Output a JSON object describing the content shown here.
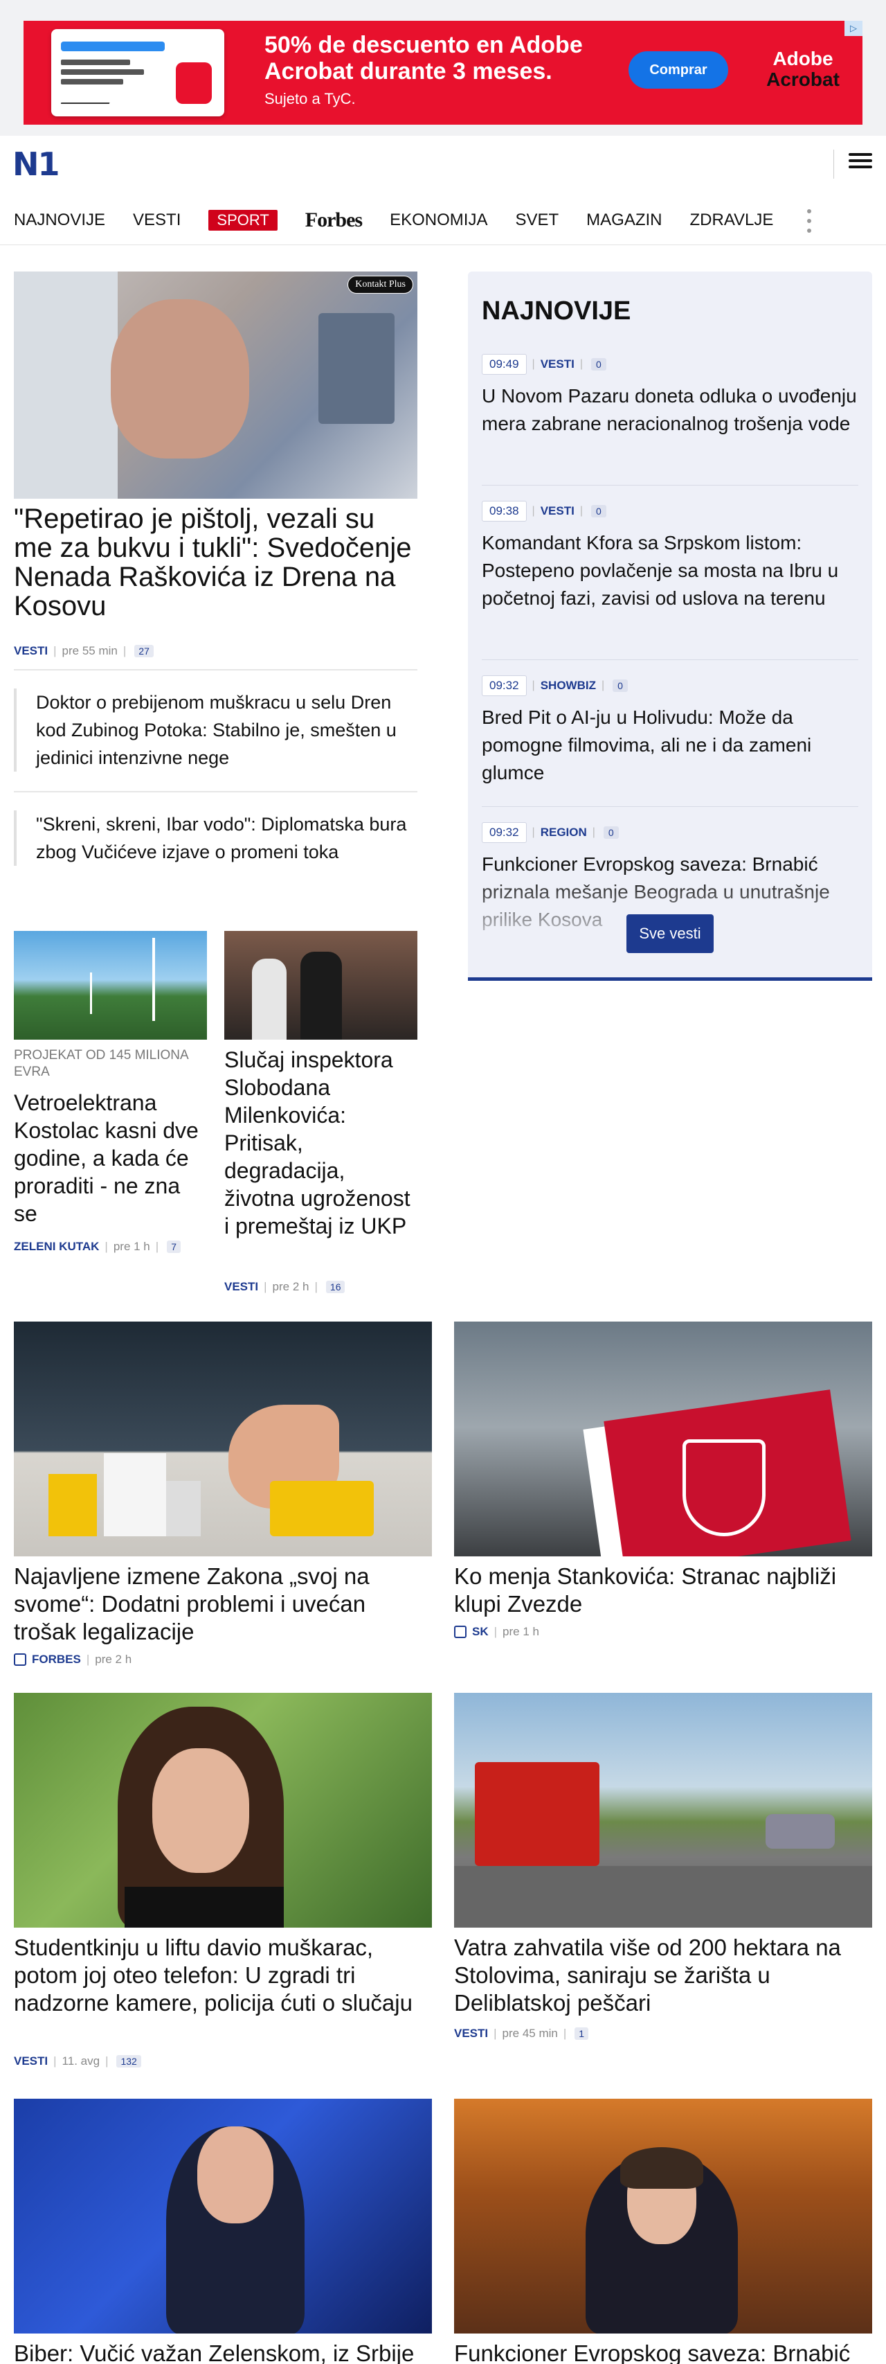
{
  "ad": {
    "headline": "50% de descuento en Adobe Acrobat durante 3 meses.",
    "subline": "Sujeto a TyC.",
    "cta": "Comprar",
    "brand_line1": "Adobe",
    "brand_line2": "Acrobat",
    "corner": "▷",
    "brand_color": "#e8112d"
  },
  "header": {
    "logo": "N1",
    "menu_icon": "hamburger-icon",
    "brand_color": "#1d3a8f"
  },
  "nav": {
    "items": [
      "NAJNOVIJE",
      "VESTI",
      "SPORT",
      "Forbes",
      "EKONOMIJA",
      "SVET",
      "MAGAZIN",
      "ZDRAVLJE"
    ],
    "more_icon": "vertical-dots-icon"
  },
  "lead": {
    "image_badge": "Kontakt Plus",
    "title": "\"Repetirao je pištolj, vezali su me za bukvu i tukli\": Svedočenje Nenada Raškovića iz Drena na Kosovu",
    "category": "VESTI",
    "time": "pre 55 min",
    "comments": "27"
  },
  "related": [
    {
      "title": "Doktor o prebijenom muškracu u selu Dren kod Zubinog Potoka: Stabilno je, smešten u jedinici intenzivne nege"
    },
    {
      "title": "\"Skreni, skreni, Ibar vodo\": Diplomatska bura zbog Vučićeve izjave o promeni toka"
    }
  ],
  "small_cards": [
    {
      "kicker": "PROJEKAT OD 145 MILIONA EVRA",
      "title": "Vetroelektrana Kostolac kasni dve godine, a kada će proraditi - ne zna se",
      "category": "ZELENI KUTAK",
      "time": "pre 1 h",
      "comments": "7"
    },
    {
      "title": "Slučaj inspektora Slobodana Milenkovića: Pritisak, degradacija, životna ugroženost i premeštaj iz UKP",
      "category": "VESTI",
      "time": "pre 2 h",
      "comments": "16"
    }
  ],
  "latest": {
    "heading": "NAJNOVIJE",
    "items": [
      {
        "time": "09:49",
        "category": "VESTI",
        "comments": "0",
        "title": "U Novom Pazaru doneta odluka o uvođenju mera zabrane neracionalnog trošenja vode"
      },
      {
        "time": "09:38",
        "category": "VESTI",
        "comments": "0",
        "title": "Komandant Kfora sa Srpskom listom: Postepeno povlačenje sa mosta na Ibru u početnoj fazi, zavisi od uslova na terenu"
      },
      {
        "time": "09:32",
        "category": "SHOWBIZ",
        "comments": "0",
        "title": "Bred Pit o AI-ju u Holivudu: Može da pomogne filmovima, ali ne i da zameni glumce"
      },
      {
        "time": "09:32",
        "category": "REGION",
        "comments": "0",
        "title": "Funkcioner Evropskog saveza: Brnabić priznala mešanje Beograda u unutrašnje prilike Kosova"
      }
    ],
    "see_all": "Sve vesti"
  },
  "grid": [
    {
      "title": "Najavljene izmene Zakona „svoj na svome“: Dodatni problemi i uvećan trošak legalizacije",
      "category": "FORBES",
      "time": "pre 2 h",
      "external": true
    },
    {
      "title": "Ko menja Stankovića: Stranac najbliži klupi Zvezde",
      "category": "SK",
      "time": "pre 1 h",
      "external": true
    },
    {
      "title": "Studentkinju u liftu davio muškarac, potom joj oteo telefon: U zgradi tri nadzorne kamere, policija ćuti o slučaju",
      "category": "VESTI",
      "time": "11. avg",
      "comments": "132"
    },
    {
      "title": "Vatra zahvatila više od 200 hektara na Stolovima, saniraju se žarišta u Deliblatskoj peščari",
      "category": "VESTI",
      "time": "pre 45 min",
      "comments": "1"
    },
    {
      "title": "Biber: Vučić važan Zelenskom, iz Srbije"
    },
    {
      "title": "Funkcioner Evropskog saveza: Brnabić"
    }
  ]
}
